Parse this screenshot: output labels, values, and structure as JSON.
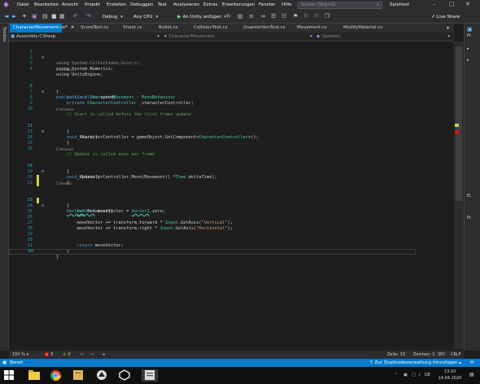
{
  "menubar": {
    "items": [
      "Datei",
      "Bearbeiten",
      "Ansicht",
      "Projekt",
      "Erstellen",
      "Debuggen",
      "Test",
      "Analysieren",
      "Extras",
      "Erweiterungen",
      "Fenster",
      "Hilfe"
    ],
    "search_placeholder": "Suchen (Strg+Q)",
    "project_name": "Spieltest"
  },
  "toolbar": {
    "configuration": "Debug",
    "platform": "Any CPU",
    "run_label": "An Unity anfügen",
    "live_share": "Live Share"
  },
  "sidebar": {
    "toolbox_label": "Toolbox"
  },
  "tabs": [
    {
      "label": "CharacterMovement.cs*",
      "active": true
    },
    {
      "label": "ScoreText.cs",
      "active": false
    },
    {
      "label": "Shoot.cs",
      "active": false
    },
    {
      "label": "Bullet.cs",
      "active": false
    },
    {
      "label": "CollisionTest.cs",
      "active": false
    },
    {
      "label": "QuantertionTest.cs",
      "active": false
    },
    {
      "label": "Movement.cs",
      "active": false
    },
    {
      "label": "ModifyMaterial.cs",
      "active": false
    }
  ],
  "navbar": {
    "project": "Assembly-CSharp",
    "class": "CharacterMovement",
    "member": "Update()"
  },
  "editor": {
    "lines": [
      {
        "n": "1",
        "code": "using System.Collections;"
      },
      {
        "n": "2",
        "code": "using System.Collections.Generic;"
      },
      {
        "n": "3",
        "code": "using System.Numerics;"
      },
      {
        "n": "4",
        "code": "using UnityEngine;"
      },
      {
        "n": "5",
        "code": "public class CharacterMovement : MonoBehaviour",
        "ref": "0 Verweise"
      },
      {
        "n": "6",
        "code": "{"
      },
      {
        "n": "7",
        "code": "    public float speed;"
      },
      {
        "n": "8",
        "code": "    private CharacterController _characterController;"
      },
      {
        "n": "9",
        "code": ""
      },
      {
        "n": "10",
        "code": "    // Start is called before the first frame update"
      },
      {
        "n": "11",
        "code": "    void Start()",
        "ref": "0 Verweise"
      },
      {
        "n": "12",
        "code": "    {"
      },
      {
        "n": "13",
        "code": "        _characterController = gameObject.GetComponent<CharacterController>();"
      },
      {
        "n": "14",
        "code": "    }"
      },
      {
        "n": "15",
        "code": ""
      },
      {
        "n": "16",
        "code": "    // Update is called once per frame"
      },
      {
        "n": "17",
        "code": "    void Update()",
        "ref": "0 Verweise"
      },
      {
        "n": "18",
        "code": "    {"
      },
      {
        "n": "19",
        "code": "        _characterController.Move(Movement() *Time.deltaTime);"
      },
      {
        "n": "20",
        "code": "    }"
      },
      {
        "n": "21",
        "code": ""
      },
      {
        "n": "22",
        "code": "    Vector3 Movement()",
        "ref": "1 Verweis"
      },
      {
        "n": "23",
        "code": "    {"
      },
      {
        "n": "24",
        "code": "        Vector3 moveVector = Vector3.zero;"
      },
      {
        "n": "25",
        "code": ""
      },
      {
        "n": "26",
        "code": "        moveVector += transform.forward * Input.GetAxis(\"Vertical\");"
      },
      {
        "n": "27",
        "code": "        moveVector += transform.right * Input.GetAxis(\"Horizontal\");"
      },
      {
        "n": "28",
        "code": ""
      },
      {
        "n": "29",
        "code": ""
      },
      {
        "n": "30",
        "code": "        return moveVector;"
      },
      {
        "n": "31",
        "code": "    }"
      },
      {
        "n": "32",
        "code": "}"
      },
      {
        "n": "33",
        "code": ""
      }
    ]
  },
  "right_pane": {
    "labels": [
      "Pr.",
      "El.",
      "Pr."
    ]
  },
  "editor_bottom": {
    "zoom": "100 %",
    "errors": "3",
    "warnings": "0",
    "line": "Zeile: 33",
    "col": "Zeichen: 1",
    "mode": "SPC",
    "eol": "CRLF"
  },
  "statusbar": {
    "state": "Bereit",
    "source_control": "Zur Quellcodeverwaltung hinzufügen"
  },
  "taskbar": {
    "lang": "DE",
    "time": "13:10",
    "date": "14.04.2020"
  },
  "colors": {
    "accent": "#007acc",
    "editor_bg": "#1e1e1e",
    "keyword": "#569cd6",
    "type": "#4ec9b0",
    "comment": "#57a64a",
    "string": "#d69d85"
  }
}
